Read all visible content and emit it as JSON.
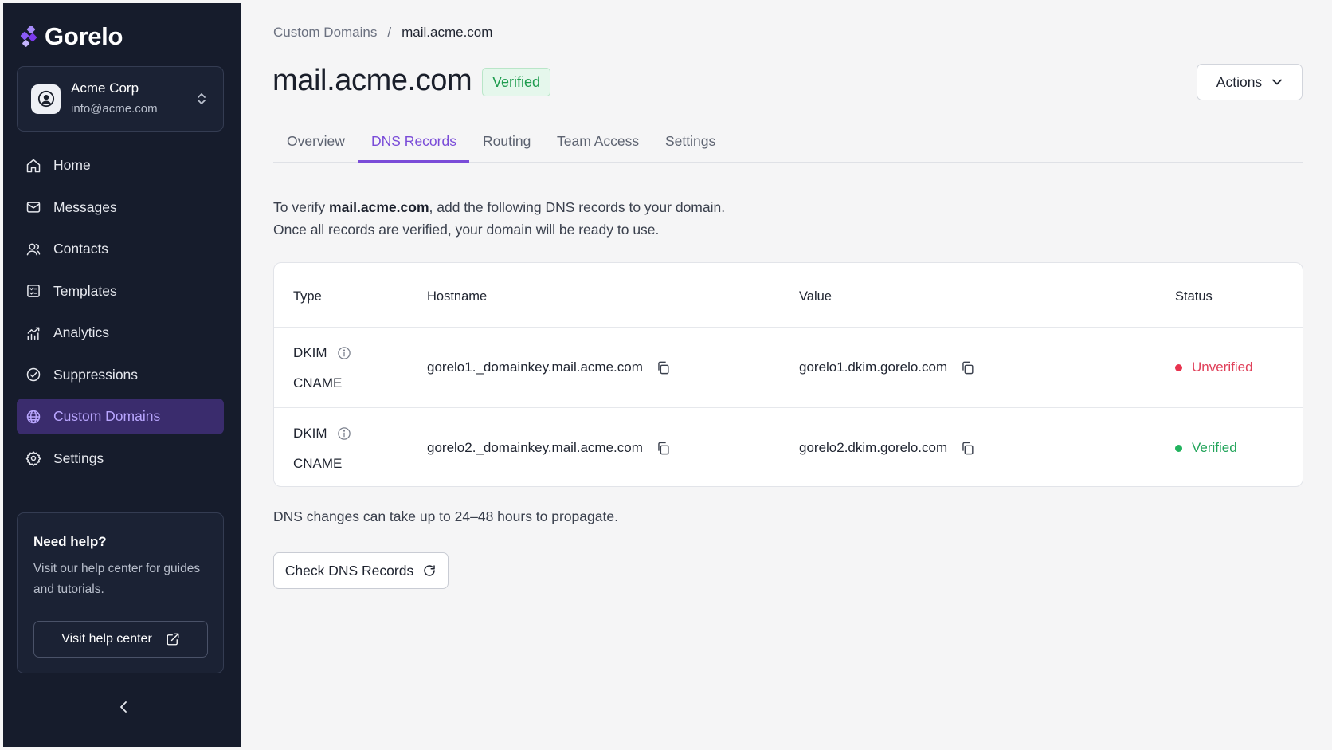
{
  "brand": {
    "name": "Gorelo",
    "accent": "#7a4cd8"
  },
  "account": {
    "name": "Acme Corp",
    "email": "info@acme.com"
  },
  "nav": {
    "items": [
      {
        "label": "Home",
        "icon": "home-icon"
      },
      {
        "label": "Messages",
        "icon": "mail-icon"
      },
      {
        "label": "Contacts",
        "icon": "contacts-icon"
      },
      {
        "label": "Templates",
        "icon": "templates-icon"
      },
      {
        "label": "Analytics",
        "icon": "analytics-icon"
      },
      {
        "label": "Suppressions",
        "icon": "suppressions-icon"
      },
      {
        "label": "Custom Domains",
        "icon": "globe-icon",
        "active": true
      },
      {
        "label": "Settings",
        "icon": "gear-icon"
      }
    ]
  },
  "help": {
    "title": "Need help?",
    "text": "Visit our help center for guides and tutorials.",
    "button_label": "Visit help center"
  },
  "breadcrumb": {
    "parent": "Custom Domains",
    "separator": "/",
    "current": "mail.acme.com"
  },
  "page": {
    "title": "mail.acme.com",
    "badge": "Verified",
    "actions_label": "Actions"
  },
  "tabs": [
    {
      "label": "Overview"
    },
    {
      "label": "DNS Records",
      "active": true
    },
    {
      "label": "Routing"
    },
    {
      "label": "Team Access"
    },
    {
      "label": "Settings"
    }
  ],
  "intro": {
    "prefix": "To verify ",
    "domain": "mail.acme.com",
    "suffix": ", add the following DNS records to your domain.",
    "line2": "Once all records are verified, your domain will be ready to use."
  },
  "table": {
    "headers": {
      "type": "Type",
      "hostname": "Hostname",
      "value": "Value",
      "status": "Status"
    },
    "rows": [
      {
        "type_name": "DKIM",
        "record_type": "CNAME",
        "hostname": "gorelo1._domainkey.mail.acme.com",
        "value": "gorelo1.dkim.gorelo.com",
        "status": "Unverified",
        "status_color": "#e0405a"
      },
      {
        "type_name": "DKIM",
        "record_type": "CNAME",
        "hostname": "gorelo2._domainkey.mail.acme.com",
        "value": "gorelo2.dkim.gorelo.com",
        "status": "Verified",
        "status_color": "#22a45a"
      }
    ]
  },
  "propagate_note": "DNS changes can take up to 24–48 hours to propagate.",
  "check_button_label": "Check DNS Records"
}
